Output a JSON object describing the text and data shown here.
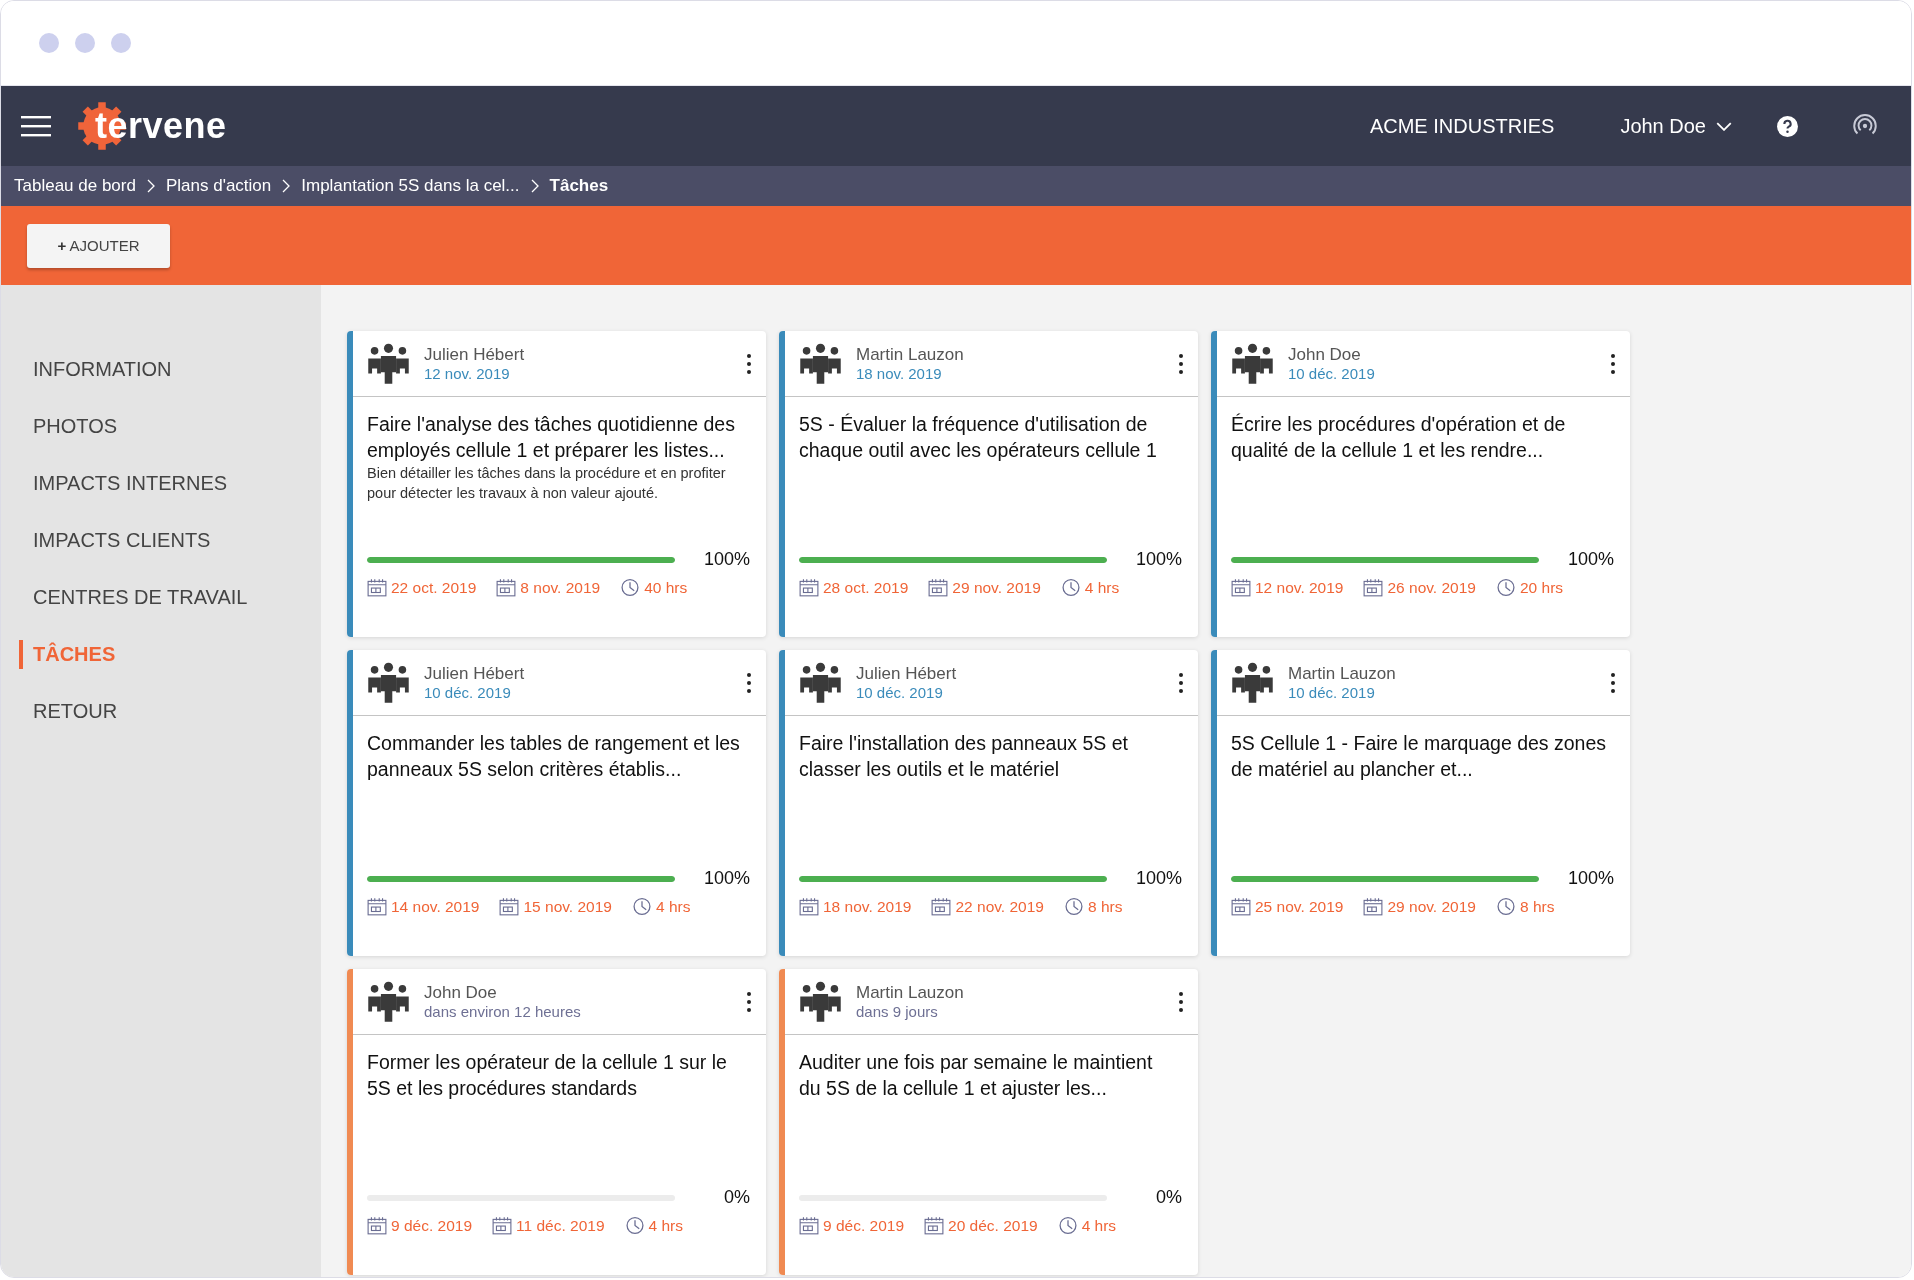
{
  "header": {
    "logo": "tervene",
    "company": "ACME INDUSTRIES",
    "user": "John Doe"
  },
  "breadcrumb": [
    {
      "label": "Tableau de bord",
      "current": false
    },
    {
      "label": "Plans d'action",
      "current": false
    },
    {
      "label": "Implantation 5S dans la cel...",
      "current": false
    },
    {
      "label": "Tâches",
      "current": true
    }
  ],
  "toolbar": {
    "add_button": {
      "icon": "+",
      "label": "AJOUTER"
    }
  },
  "sidebar": {
    "items": [
      {
        "label": "INFORMATION",
        "selected": false
      },
      {
        "label": "PHOTOS",
        "selected": false
      },
      {
        "label": "IMPACTS INTERNES",
        "selected": false
      },
      {
        "label": "IMPACTS CLIENTS",
        "selected": false
      },
      {
        "label": "CENTRES DE TRAVAIL",
        "selected": false
      },
      {
        "label": "TÂCHES",
        "selected": true
      },
      {
        "label": "RETOUR",
        "selected": false
      }
    ]
  },
  "tasks": [
    {
      "kind": "scheduled",
      "color": "#3a8bba",
      "assignee": "Julien Hébert",
      "date": "12 nov. 2019",
      "title": "Faire l'analyse des tâches quotidienne des employés cellule 1 et préparer les listes...",
      "description": "Bien détailler les tâches dans la procédure et en profiter pour détecter les travaux à non valeur ajouté.",
      "level": 1,
      "percent": "100%",
      "start": "22 oct. 2019",
      "end": "8 nov. 2019",
      "hours": "40 hrs"
    },
    {
      "kind": "scheduled",
      "color": "#3a8bba",
      "assignee": "Martin Lauzon",
      "date": "18 nov. 2019",
      "title": "5S - Évaluer la fréquence d'utilisation de chaque outil avec les opérateurs cellule 1",
      "level": 1,
      "percent": "100%",
      "start": "28 oct. 2019",
      "end": "29 nov. 2019",
      "hours": "4 hrs"
    },
    {
      "kind": "scheduled",
      "color": "#3a8bba",
      "assignee": "John Doe",
      "date": "10 déc. 2019",
      "title": "Écrire les procédures d'opération et de qualité de la cellule 1 et les rendre...",
      "level": 1,
      "percent": "100%",
      "start": "12 nov. 2019",
      "end": "26 nov. 2019",
      "hours": "20 hrs"
    },
    {
      "kind": "scheduled",
      "color": "#3a8bba",
      "assignee": "Julien Hébert",
      "date": "10 déc. 2019",
      "title": "Commander les tables de rangement et les panneaux 5S selon critères établis...",
      "level": 1,
      "percent": "100%",
      "start": "14 nov. 2019",
      "end": "15 nov. 2019",
      "hours": "4 hrs"
    },
    {
      "kind": "scheduled",
      "color": "#3a8bba",
      "assignee": "Julien Hébert",
      "date": "10 déc. 2019",
      "title": "Faire l'installation des panneaux 5S et classer les outils et le matériel",
      "level": 1,
      "percent": "100%",
      "start": "18 nov. 2019",
      "end": "22 nov. 2019",
      "hours": "8 hrs"
    },
    {
      "kind": "scheduled",
      "color": "#3a8bba",
      "assignee": "Martin Lauzon",
      "date": "10 déc. 2019",
      "title": "5S Cellule 1 - Faire le marquage des zones de matériel au plancher et...",
      "level": 1,
      "percent": "100%",
      "start": "25 nov. 2019",
      "end": "29 nov. 2019",
      "hours": "8 hrs"
    },
    {
      "kind": "relative",
      "color": "#f08a52",
      "assignee": "John Doe",
      "date": "dans environ 12 heures",
      "title": "Former les opérateur de la cellule 1 sur le 5S et les procédures standards",
      "level": 0,
      "percent": "0%",
      "start": "9 déc. 2019",
      "end": "11 déc. 2019",
      "hours": "4 hrs"
    },
    {
      "kind": "relative",
      "color": "#f08a52",
      "assignee": "Martin Lauzon",
      "date": "dans 9 jours",
      "title": "Auditer une fois par semaine le maintient du 5S de la cellule 1 et ajuster les...",
      "level": 0,
      "percent": "0%",
      "start": "9 déc. 2019",
      "end": "20 déc. 2019",
      "hours": "4 hrs"
    }
  ]
}
